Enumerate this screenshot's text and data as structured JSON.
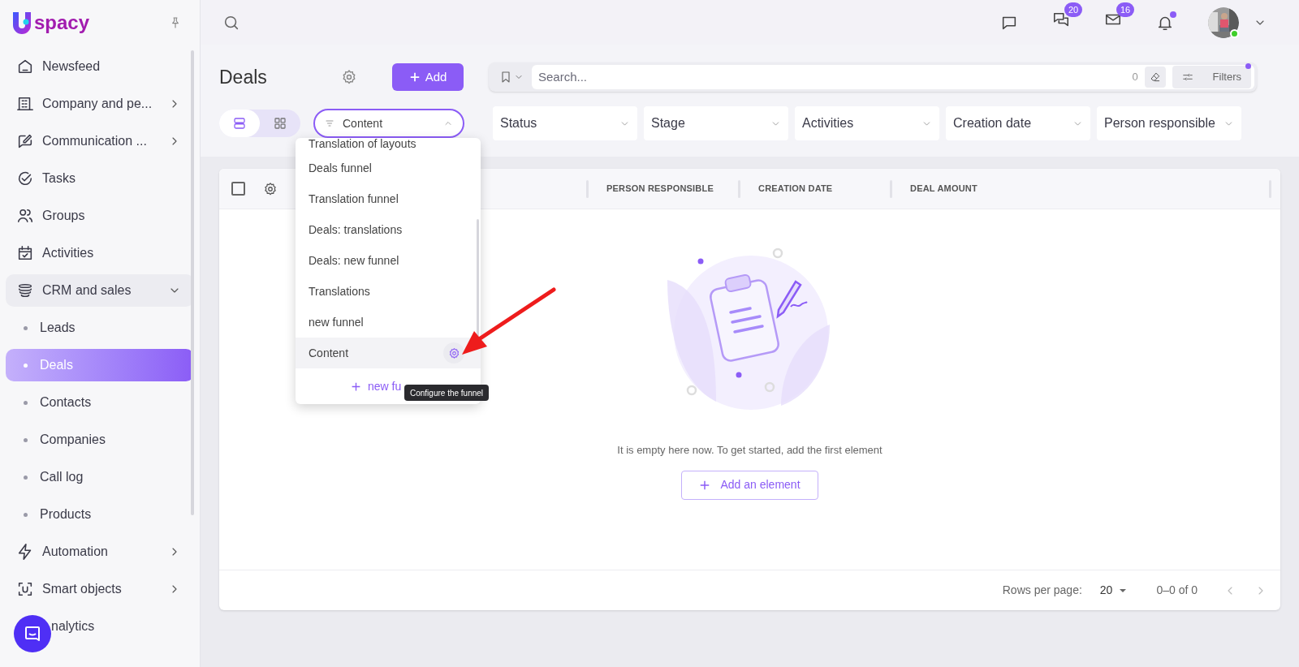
{
  "logo": {
    "text": "spacy"
  },
  "sidebar": {
    "items": [
      {
        "label": "Newsfeed",
        "kind": "link",
        "selected": false
      },
      {
        "label": "Company and pe...",
        "kind": "group",
        "expanded": false,
        "selected": false
      },
      {
        "label": "Communication ...",
        "kind": "group",
        "expanded": false,
        "selected": false
      },
      {
        "label": "Tasks",
        "kind": "link",
        "selected": false
      },
      {
        "label": "Groups",
        "kind": "link",
        "selected": false
      },
      {
        "label": "Activities",
        "kind": "link",
        "selected": false
      },
      {
        "label": "CRM and sales",
        "kind": "group",
        "expanded": true,
        "selected": false,
        "children": [
          {
            "label": "Leads",
            "selected": false
          },
          {
            "label": "Deals",
            "selected": true
          },
          {
            "label": "Contacts",
            "selected": false
          },
          {
            "label": "Companies",
            "selected": false
          },
          {
            "label": "Call log",
            "selected": false
          },
          {
            "label": "Products",
            "selected": false
          }
        ]
      },
      {
        "label": "Automation",
        "kind": "group",
        "expanded": false,
        "selected": false
      },
      {
        "label": "Smart objects",
        "kind": "group",
        "expanded": false,
        "selected": false
      },
      {
        "label": "nalytics",
        "kind": "link",
        "selected": false
      }
    ]
  },
  "topbar": {
    "messages_badge": "20",
    "mail_badge": "16",
    "notifications_unread": true,
    "user_online": true
  },
  "page": {
    "title": "Deals",
    "add_button": "Add",
    "search": {
      "placeholder": "Search...",
      "count": "0",
      "filters_button": "Filters",
      "filters_active": true
    },
    "views": [
      {
        "kind": "list",
        "selected": true
      },
      {
        "kind": "grid",
        "selected": false
      }
    ],
    "funnel_select": {
      "value": "Content",
      "expanded": true
    },
    "filters": [
      "Status",
      "Stage",
      "Activities",
      "Creation date",
      "Person responsible"
    ]
  },
  "funnel_menu": {
    "items": [
      {
        "label": "Translation of layouts",
        "selected": false
      },
      {
        "label": "Deals funnel",
        "selected": false
      },
      {
        "label": "Translation funnel",
        "selected": false
      },
      {
        "label": "Deals: translations",
        "selected": false
      },
      {
        "label": "Deals: new funnel",
        "selected": false
      },
      {
        "label": "Translations",
        "selected": false
      },
      {
        "label": "new funnel",
        "selected": false
      },
      {
        "label": "Content",
        "selected": true
      }
    ],
    "new_button": "new fu",
    "tooltip": "Configure the funnel"
  },
  "table": {
    "select_all_checked": false,
    "columns": [
      "PERSON RESPONSIBLE",
      "CREATION DATE",
      "DEAL AMOUNT"
    ],
    "empty_message": "It is empty here now. To get started, add the first element",
    "add_button": "Add an element",
    "footer": {
      "rows_per_page_label": "Rows per page:",
      "rows_per_page": "20",
      "range": "0–0 of 0"
    }
  }
}
